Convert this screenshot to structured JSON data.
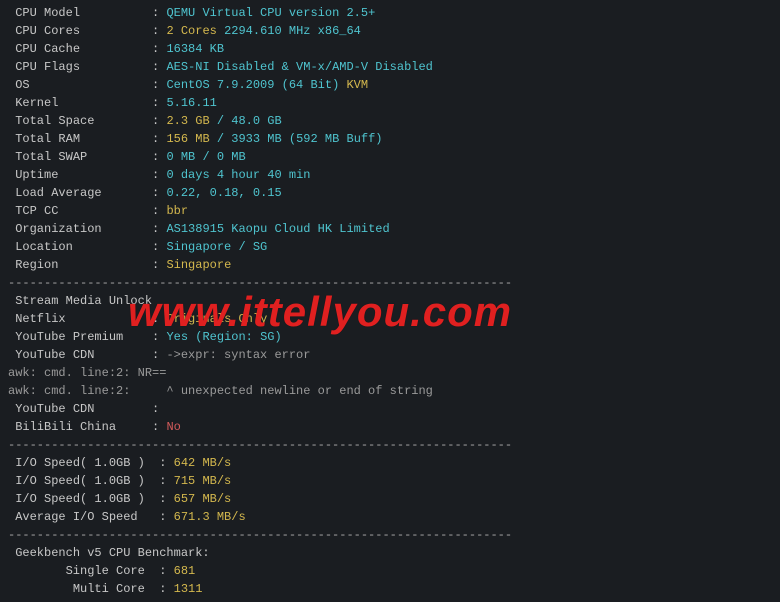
{
  "dash_line": "----------------------------------------------------------------------",
  "sys": {
    "cpu_model": {
      "label": "CPU Model",
      "value": "QEMU Virtual CPU version 2.5+"
    },
    "cpu_cores": {
      "label": "CPU Cores",
      "cores": "2 Cores",
      "freq": "2294.610 MHz x86_64"
    },
    "cpu_cache": {
      "label": "CPU Cache",
      "value": "16384 KB"
    },
    "cpu_flags": {
      "label": "CPU Flags",
      "value": "AES-NI Disabled & VM-x/AMD-V Disabled"
    },
    "os": {
      "label": "OS",
      "value": "CentOS 7.9.2009 (64 Bit)",
      "virt": "KVM"
    },
    "kernel": {
      "label": "Kernel",
      "value": "5.16.11"
    },
    "total_space": {
      "label": "Total Space",
      "used": "2.3 GB",
      "slash": " / ",
      "total": "48.0 GB"
    },
    "total_ram": {
      "label": "Total RAM",
      "used": "156 MB",
      "slash": " / ",
      "total": "3933 MB",
      "buff": "(592 MB Buff)"
    },
    "total_swap": {
      "label": "Total SWAP",
      "value": "0 MB / 0 MB"
    },
    "uptime": {
      "label": "Uptime",
      "value": "0 days 4 hour 40 min"
    },
    "load_avg": {
      "label": "Load Average",
      "value": "0.22, 0.18, 0.15"
    },
    "tcp_cc": {
      "label": "TCP CC",
      "value": "bbr"
    },
    "organization": {
      "label": "Organization",
      "value": "AS138915 Kaopu Cloud HK Limited"
    },
    "location": {
      "label": "Location",
      "value": "Singapore / SG"
    },
    "region": {
      "label": "Region",
      "value": "Singapore"
    }
  },
  "stream": {
    "header": "Stream Media Unlock",
    "netflix": {
      "label": "Netflix",
      "value": "Originals Only"
    },
    "yt_premium": {
      "label": "YouTube Premium",
      "value": "Yes (Region: SG)"
    },
    "yt_cdn1": {
      "label": "YouTube CDN",
      "value": "->expr: syntax error"
    },
    "awk1": "awk: cmd. line:2: NR==",
    "awk2": "awk: cmd. line:2:     ^ unexpected newline or end of string",
    "yt_cdn2": {
      "label": "YouTube CDN",
      "value": ""
    },
    "bilibili": {
      "label": "BiliBili China",
      "value": "No"
    }
  },
  "io": {
    "r1": {
      "label": "I/O Speed( 1.0GB )",
      "value": "642 MB/s"
    },
    "r2": {
      "label": "I/O Speed( 1.0GB )",
      "value": "715 MB/s"
    },
    "r3": {
      "label": "I/O Speed( 1.0GB )",
      "value": "657 MB/s"
    },
    "avg": {
      "label": "Average I/O Speed",
      "value": "671.3 MB/s"
    }
  },
  "geekbench": {
    "header": "Geekbench v5 CPU Benchmark:",
    "single": {
      "label": "Single Core",
      "value": "681"
    },
    "multi": {
      "label": "Multi Core",
      "value": "1311"
    }
  },
  "watermark": "www.ittellyou.com"
}
